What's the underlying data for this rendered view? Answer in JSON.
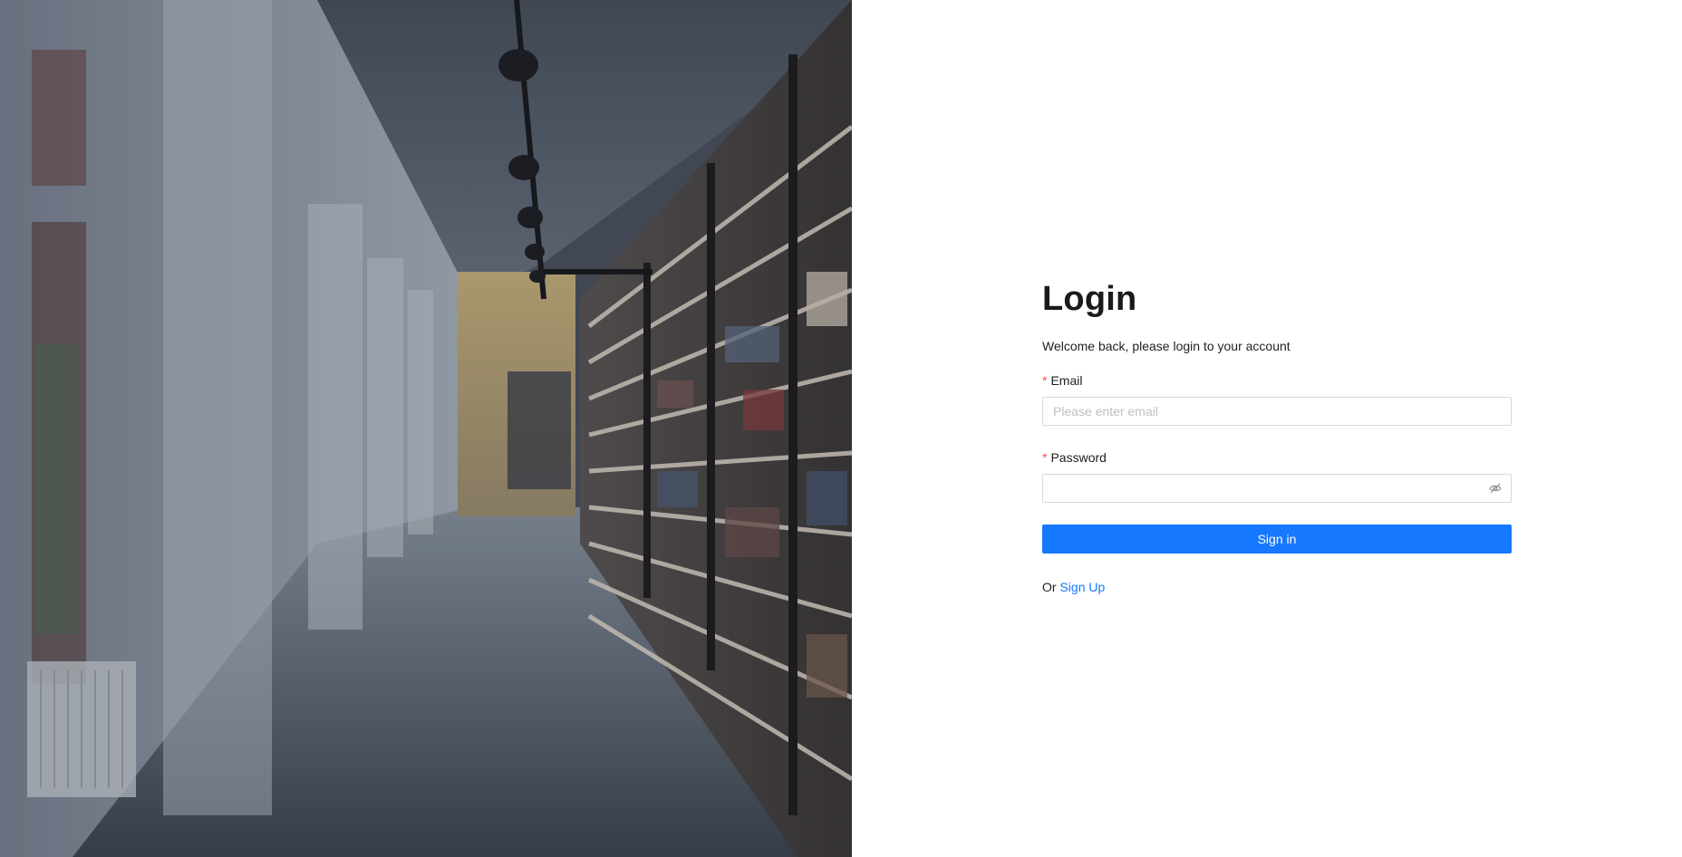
{
  "hero": {
    "image_subject": "library-corridor-illustration"
  },
  "login": {
    "title": "Login",
    "subtitle": "Welcome back, please login to your account",
    "email": {
      "required_mark": "*",
      "label": "Email",
      "placeholder": "Please enter email",
      "value": ""
    },
    "password": {
      "required_mark": "*",
      "label": "Password",
      "placeholder": "",
      "value": "",
      "visibility_icon": "eye-invisible-icon"
    },
    "sign_in_label": "Sign in",
    "alt_prefix": "Or",
    "sign_up_label": "Sign Up"
  },
  "colors": {
    "primary": "#1677ff",
    "required": "#ff4d4f",
    "border": "#d9d9d9",
    "text": "#1f1f1f",
    "placeholder": "#bfbfbf"
  }
}
